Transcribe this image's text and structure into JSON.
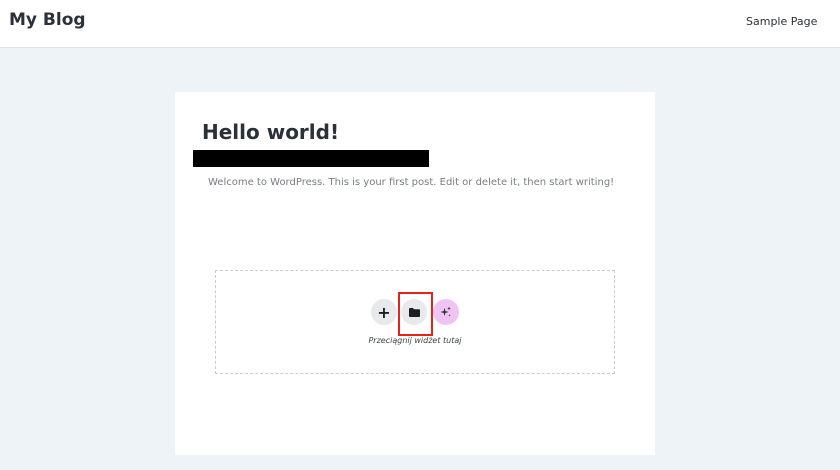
{
  "header": {
    "site_title": "My Blog",
    "nav_link": "Sample Page"
  },
  "post": {
    "title": "Hello world!",
    "excerpt": "Welcome to WordPress. This is your first post. Edit or delete it, then start writing!"
  },
  "drop_zone": {
    "add_icon": "plus-icon",
    "template_icon": "folder-icon",
    "ai_icon": "sparkle-icon",
    "caption": "Przeciągnij widżet tutaj"
  },
  "colors": {
    "page_background": "#eef3f8",
    "card_background": "#ffffff",
    "text_dark": "#2b3138",
    "text_muted": "#777d85",
    "button_gray": "#e7e9ec",
    "button_ai": "#f0c3f5",
    "highlight": "#e1251b"
  }
}
